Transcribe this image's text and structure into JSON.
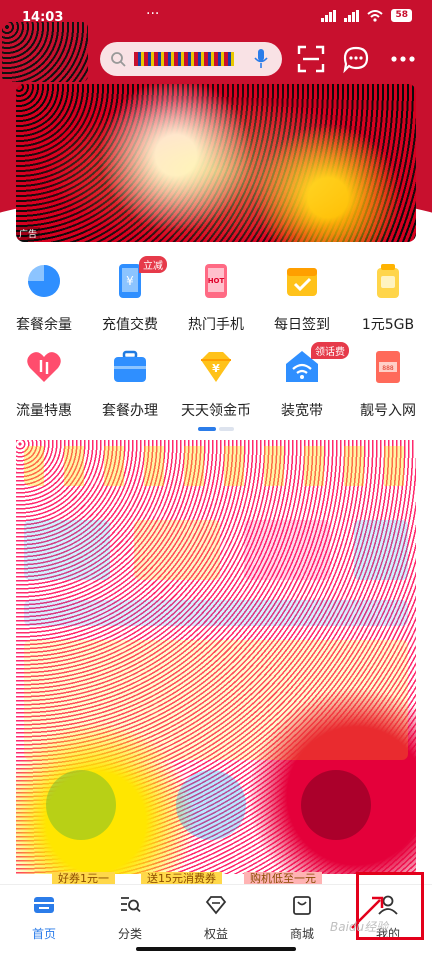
{
  "status_bar": {
    "time": "14:03",
    "dots": "···",
    "battery": "58"
  },
  "banner": {
    "ad_label": "广告"
  },
  "grid": {
    "row1": [
      {
        "label": "套餐余量",
        "icon": "pie-chart-icon",
        "color": "#2f8fff"
      },
      {
        "label": "充值交费",
        "icon": "phone-yen-icon",
        "color": "#2f8fff",
        "badge": "立减"
      },
      {
        "label": "热门手机",
        "icon": "hot-phone-icon",
        "color": "#ff4d6d"
      },
      {
        "label": "每日签到",
        "icon": "calendar-check-icon",
        "color": "#ffc21a"
      },
      {
        "label": "1元5GB",
        "icon": "gold-jar-icon",
        "color": "#ffc21a"
      }
    ],
    "row2": [
      {
        "label": "流量特惠",
        "icon": "heart-data-icon",
        "color": "#ff4d6d"
      },
      {
        "label": "套餐办理",
        "icon": "briefcase-icon",
        "color": "#2f8fff"
      },
      {
        "label": "天天领金币",
        "icon": "coin-diamond-icon",
        "color": "#ffc21a"
      },
      {
        "label": "装宽带",
        "icon": "wifi-house-icon",
        "color": "#2f8fff",
        "badge": "领话费"
      },
      {
        "label": "靓号入网",
        "icon": "number-card-icon",
        "color": "#ff6a5a"
      }
    ]
  },
  "promo": {
    "labels": [
      "好券1元一",
      "送15元消费券",
      "购机低至一元"
    ]
  },
  "nav": {
    "items": [
      {
        "label": "首页",
        "icon": "home-icon",
        "active": true
      },
      {
        "label": "分类",
        "icon": "category-search-icon"
      },
      {
        "label": "权益",
        "icon": "diamond-icon"
      },
      {
        "label": "商城",
        "icon": "shopping-bag-icon"
      },
      {
        "label": "我的",
        "icon": "user-icon"
      }
    ],
    "active_color": "#2b7ce9"
  },
  "watermark": "Baidu经验",
  "colors": {
    "brand": "#c8102e",
    "highlight": "#e3001b"
  }
}
